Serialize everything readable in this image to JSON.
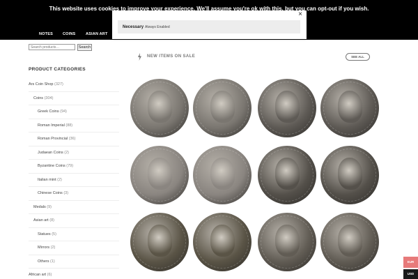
{
  "cookie": {
    "message": "This website uses cookies to improve your experience. We'll assume you're ok with this, but you can opt-out if you wish.",
    "close": "×",
    "option_name": "Necessary",
    "option_state": "Always Enabled"
  },
  "nav": {
    "items": [
      "NOTES",
      "COINS",
      "ASIAN ART"
    ]
  },
  "search": {
    "placeholder": "Search products…",
    "button": "Search"
  },
  "sidebar": {
    "heading": "PRODUCT CATEGORIES",
    "categories": [
      {
        "label": "Ars Coin Shop",
        "count": "(327)"
      },
      {
        "label": "Coins",
        "count": "(304)"
      },
      {
        "label": "Greek Coins",
        "count": "(94)"
      },
      {
        "label": "Roman Imperial",
        "count": "(88)"
      },
      {
        "label": "Roman Provincial",
        "count": "(36)"
      },
      {
        "label": "Judaean Coins",
        "count": "(2)"
      },
      {
        "label": "Byzantine Coins",
        "count": "(79)"
      },
      {
        "label": "Italian mint",
        "count": "(2)"
      },
      {
        "label": "Chinese Coins",
        "count": "(3)"
      },
      {
        "label": "Medals",
        "count": "(9)"
      },
      {
        "label": "Asian art",
        "count": "(8)"
      },
      {
        "label": "Statues",
        "count": "(5)"
      },
      {
        "label": "Mirrors",
        "count": "(2)"
      },
      {
        "label": "Others",
        "count": "(1)"
      },
      {
        "label": "African art",
        "count": "(6)"
      }
    ]
  },
  "main": {
    "section_title": "NEW ITEMS ON SALE",
    "see_all": "SEE ALL",
    "products": [
      {
        "obverse": "coin-bust-icon",
        "reverse": "coin-bust-icon",
        "tone": "#7a7670"
      },
      {
        "obverse": "coin-bust-icon",
        "reverse": "coin-bust-icon",
        "tone": "#5e5a55"
      },
      {
        "obverse": "coin-bust-icon",
        "reverse": "coin-bust-icon",
        "tone": "#8a8580"
      },
      {
        "obverse": "coin-bust-icon",
        "reverse": "coin-deity-icon",
        "tone": "#54504a"
      },
      {
        "obverse": "coin-bust-icon",
        "reverse": "coin-figure-icon",
        "tone": "#5a5446"
      },
      {
        "obverse": "coin-bust-icon",
        "reverse": "coin-temple-icon",
        "tone": "#615c54"
      }
    ]
  },
  "currency": {
    "eur": "EUR",
    "usd": "USD"
  }
}
